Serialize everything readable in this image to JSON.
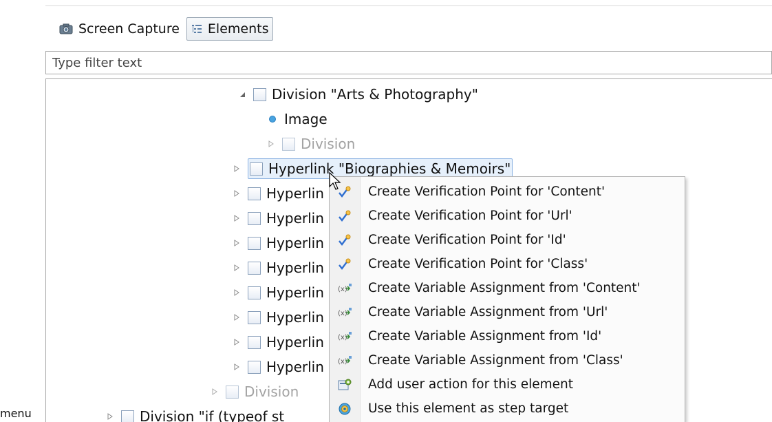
{
  "toolbar": {
    "screen_capture_label": "Screen Capture",
    "elements_label": "Elements"
  },
  "filter": {
    "placeholder": "Type filter text"
  },
  "tree": {
    "rows": [
      {
        "label": "Division \"Arts & Photography\"",
        "type": "box",
        "twisty": "expanded"
      },
      {
        "label": "Image",
        "type": "dot"
      },
      {
        "label": "Division",
        "type": "box",
        "twisty": "collapsed",
        "dim": true
      },
      {
        "label": "Hyperlink \"Biographies & Memoirs\"",
        "type": "box",
        "twisty": "collapsed",
        "selected": true
      },
      {
        "label": "Hyperlin",
        "type": "box",
        "twisty": "collapsed"
      },
      {
        "label": "Hyperlin",
        "type": "box",
        "twisty": "collapsed"
      },
      {
        "label": "Hyperlin",
        "type": "box",
        "twisty": "collapsed"
      },
      {
        "label": "Hyperlin",
        "type": "box",
        "twisty": "collapsed"
      },
      {
        "label": "Hyperlin",
        "type": "box",
        "twisty": "collapsed"
      },
      {
        "label": "Hyperlin",
        "type": "box",
        "twisty": "collapsed"
      },
      {
        "label": "Hyperlin",
        "type": "box",
        "twisty": "collapsed"
      },
      {
        "label": "Hyperlin",
        "type": "box",
        "twisty": "collapsed"
      },
      {
        "label": "Division",
        "type": "box",
        "twisty": "collapsed",
        "dim": true
      },
      {
        "label": "Division \"if (typeof st",
        "type": "box",
        "twisty": "collapsed"
      }
    ]
  },
  "context_menu": {
    "items": [
      {
        "label": "Create Verification Point for 'Content'",
        "icon": "verification-point-icon"
      },
      {
        "label": "Create Verification Point for 'Url'",
        "icon": "verification-point-icon"
      },
      {
        "label": "Create Verification Point for 'Id'",
        "icon": "verification-point-icon"
      },
      {
        "label": "Create Verification Point for 'Class'",
        "icon": "verification-point-icon"
      },
      {
        "label": "Create Variable Assignment from 'Content'",
        "icon": "variable-assignment-icon"
      },
      {
        "label": "Create Variable Assignment from 'Url'",
        "icon": "variable-assignment-icon"
      },
      {
        "label": "Create Variable Assignment from 'Id'",
        "icon": "variable-assignment-icon"
      },
      {
        "label": "Create Variable Assignment from 'Class'",
        "icon": "variable-assignment-icon"
      },
      {
        "label": "Add user action for this element",
        "icon": "user-action-icon"
      },
      {
        "label": "Use this element as step target",
        "icon": "step-target-icon"
      }
    ]
  },
  "side_label": "menu",
  "colors": {
    "accent": "#49a3e0",
    "selection": "#e6f0fb",
    "check": "#2f6fd0"
  }
}
